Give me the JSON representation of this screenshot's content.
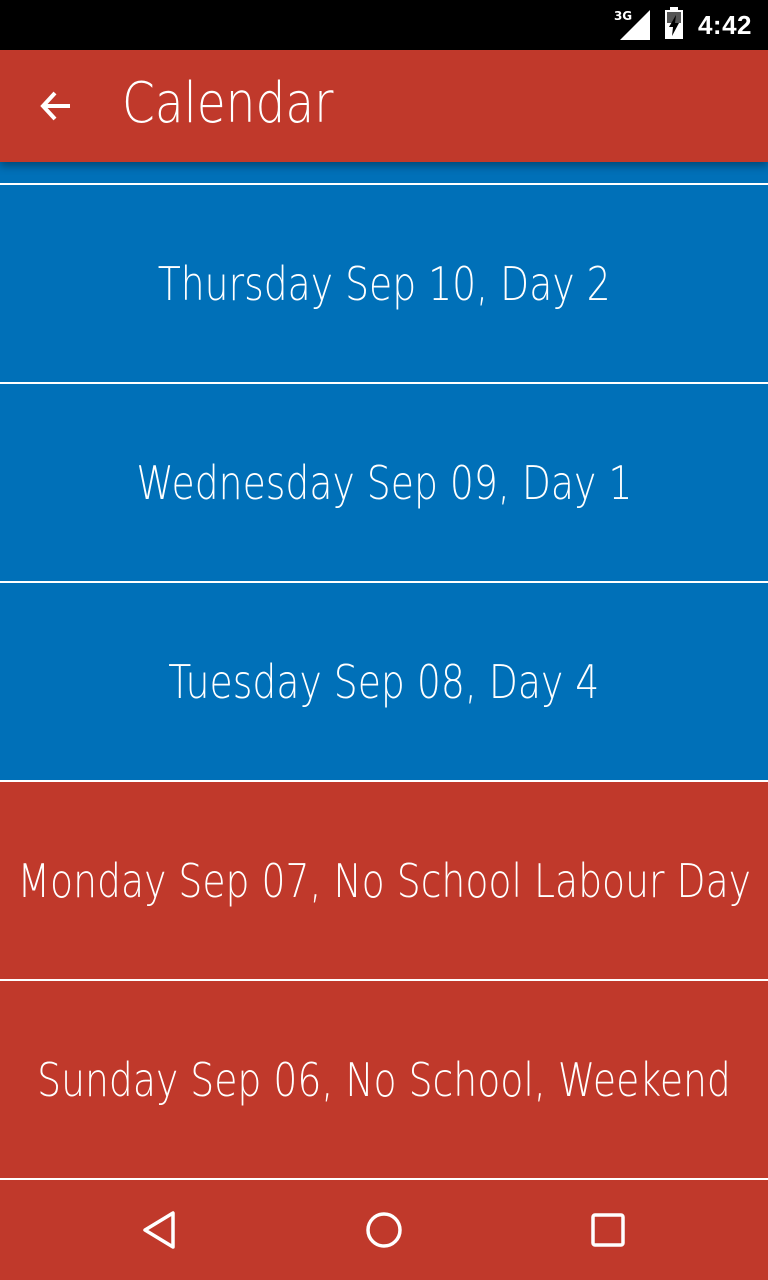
{
  "status_bar": {
    "network_type": "3G",
    "time": "4:42",
    "icons": [
      "cell-signal-icon",
      "battery-charging-icon"
    ]
  },
  "app_bar": {
    "title": "Calendar",
    "back_icon": "arrow-back-icon"
  },
  "days": [
    {
      "label": "Thursday Sep 10, Day 2",
      "status": "school"
    },
    {
      "label": "Wednesday Sep 09, Day 1",
      "status": "school"
    },
    {
      "label": "Tuesday Sep 08, Day 4",
      "status": "school"
    },
    {
      "label": "Monday Sep 07, No School Labour Day",
      "status": "no-school"
    },
    {
      "label": "Sunday Sep 06, No School, Weekend",
      "status": "no-school"
    }
  ],
  "colors": {
    "app_bar": "#c0392b",
    "school_day": "#0070b8",
    "no_school_day": "#c0392b",
    "divider": "#ffffff",
    "text": "#ffffff"
  },
  "nav_bar": {
    "buttons": [
      "back-triangle-icon",
      "home-circle-icon",
      "recents-square-icon"
    ]
  }
}
